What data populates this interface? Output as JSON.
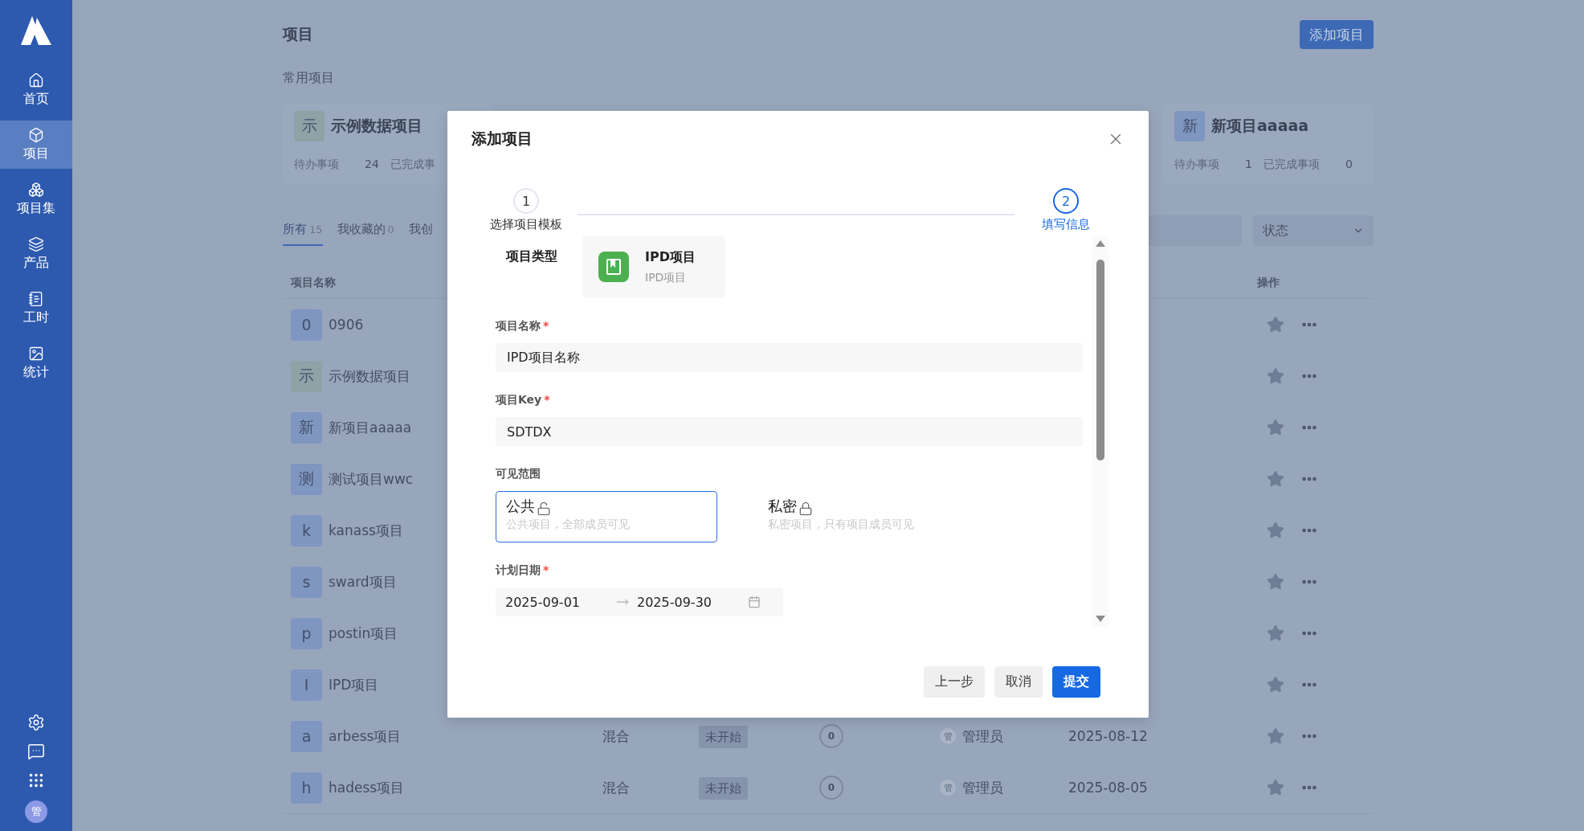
{
  "sidebar": {
    "items": [
      {
        "label": "首页",
        "selected": false
      },
      {
        "label": "项目",
        "selected": true
      },
      {
        "label": "项目集",
        "selected": false
      },
      {
        "label": "产品",
        "selected": false
      },
      {
        "label": "工时",
        "selected": false
      },
      {
        "label": "统计",
        "selected": false
      }
    ],
    "avatar": "管"
  },
  "page": {
    "title": "项目",
    "add_button": "添加项目",
    "favorites_title": "常用项目",
    "favorites": [
      {
        "avatar": "示",
        "color": "#8fa2a6",
        "name": "示例数据项目",
        "todo_label": "待办事项",
        "todo": "24",
        "done_label": "已完成事"
      },
      {
        "avatar": "新",
        "color": "#7f96c1",
        "name": "新项目aaaaa",
        "todo_label": "待办事项",
        "todo": "1",
        "done_label": "已完成事项",
        "done": "0"
      }
    ],
    "tabs": [
      {
        "label": "所有",
        "count": "15",
        "selected": true
      },
      {
        "label": "我收藏的",
        "count": "0",
        "selected": false
      },
      {
        "label": "我创",
        "selected": false
      }
    ],
    "status_filter": "状态",
    "table": {
      "columns": [
        {
          "label": "项目名称"
        },
        {
          "label": "操作"
        }
      ],
      "rows": [
        {
          "avatar": "0",
          "color": "#7f96c1",
          "name": "0906"
        },
        {
          "avatar": "示",
          "color": "#8fa2a6",
          "name": "示例数据项目"
        },
        {
          "avatar": "新",
          "color": "#7f96c1",
          "name": "新项目aaaaa"
        },
        {
          "avatar": "测",
          "color": "#7f96c1",
          "name": "测试项目wwc"
        },
        {
          "avatar": "k",
          "color": "#7f96c1",
          "name": "kanass项目"
        },
        {
          "avatar": "s",
          "color": "#7f96c1",
          "name": "sward项目"
        },
        {
          "avatar": "p",
          "color": "#7f96c1",
          "name": "postin项目"
        },
        {
          "avatar": "I",
          "color": "#7f96c1",
          "name": "IPD项目"
        },
        {
          "avatar": "a",
          "color": "#7f96c1",
          "name": "arbess项目",
          "type": "混合",
          "status": "未开始",
          "progress": "0",
          "owner_avatar": "管",
          "owner": "管理员",
          "date": "2025-08-12"
        },
        {
          "avatar": "h",
          "color": "#7f96c1",
          "name": "hadess项目",
          "type": "混合",
          "status": "未开始",
          "progress": "0",
          "owner_avatar": "管",
          "owner": "管理员",
          "date": "2025-08-05"
        }
      ]
    }
  },
  "dialog": {
    "title": "添加项目",
    "steps": [
      {
        "number": "1",
        "label": "选择项目模板",
        "selected": false
      },
      {
        "number": "2",
        "label": "填写信息",
        "selected": true
      }
    ],
    "type_label": "项目类型",
    "template": {
      "name": "IPD项目",
      "description": "IPD项目"
    },
    "fields": [
      {
        "label": "项目名称",
        "required_mark": "*",
        "value": "IPD项目名称"
      },
      {
        "label": "项目Key",
        "required_mark": "*",
        "value": "SDTDX"
      }
    ],
    "visibility": {
      "label": "可见范围",
      "options": [
        {
          "title": "公共",
          "description": "公共项目，全部成员可见",
          "locked": false,
          "selected": true
        },
        {
          "title": "私密",
          "description": "私密项目，只有项目成员可见",
          "locked": true,
          "selected": false
        }
      ]
    },
    "date": {
      "label": "计划日期",
      "required_mark": "*",
      "start": "2025-09-01",
      "end": "2025-09-30"
    },
    "buttons": [
      {
        "label": "上一步",
        "kind": "secondary"
      },
      {
        "label": "取消",
        "kind": "secondary"
      },
      {
        "label": "提交",
        "kind": "primary"
      }
    ]
  }
}
